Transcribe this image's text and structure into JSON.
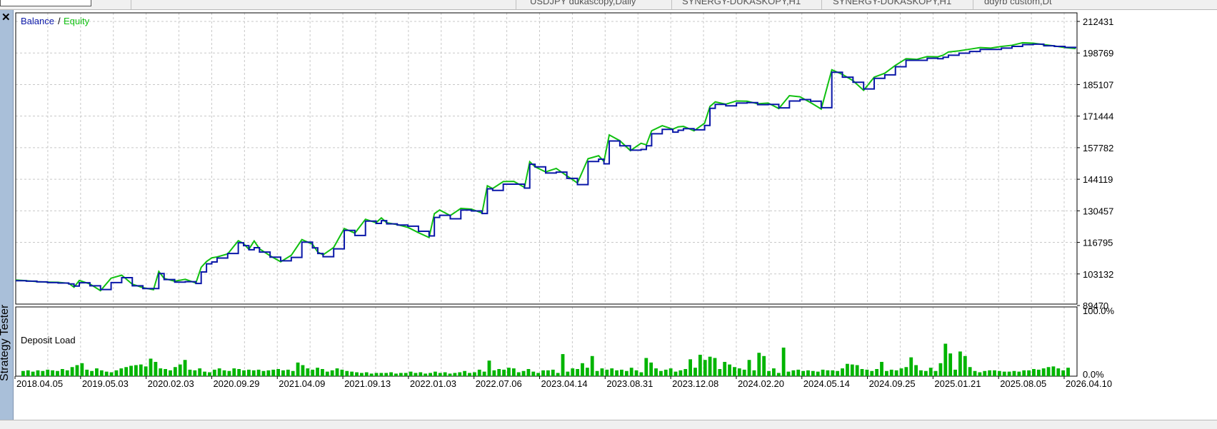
{
  "tabs": {
    "items": [
      "USDJPY dukascopy,Daily",
      "SYNERGY-DUKASKOPY,H1",
      "SYNERGY-DUKASKOPY,H1",
      "ddyrb custom,Dt"
    ]
  },
  "side_panel": {
    "title": "Strategy Tester",
    "close_icon": "close-icon"
  },
  "colors": {
    "balance": "#0a17a8",
    "equity": "#10c010",
    "deposit_bars": "#00b400",
    "grid": "#c8c8c8"
  },
  "chart_data": [
    {
      "type": "line",
      "legend": {
        "balance_label": "Balance",
        "separator": "/",
        "equity_label": "Equity",
        "placement": "top-left"
      },
      "y_ticks": [
        "212431",
        "198769",
        "185107",
        "171444",
        "157782",
        "144119",
        "130457",
        "116795",
        "103132",
        "89470"
      ],
      "ylim": [
        89470,
        212431
      ],
      "grid": true,
      "x": [
        0,
        0.01,
        0.02,
        0.03,
        0.04,
        0.05,
        0.055,
        0.06,
        0.07,
        0.08,
        0.09,
        0.1,
        0.11,
        0.12,
        0.13,
        0.135,
        0.14,
        0.15,
        0.16,
        0.17,
        0.175,
        0.18,
        0.185,
        0.19,
        0.2,
        0.21,
        0.215,
        0.22,
        0.225,
        0.23,
        0.24,
        0.25,
        0.26,
        0.27,
        0.28,
        0.285,
        0.29,
        0.3,
        0.31,
        0.32,
        0.33,
        0.34,
        0.345,
        0.35,
        0.36,
        0.37,
        0.38,
        0.39,
        0.395,
        0.4,
        0.41,
        0.42,
        0.43,
        0.44,
        0.445,
        0.45,
        0.46,
        0.47,
        0.48,
        0.485,
        0.49,
        0.5,
        0.51,
        0.52,
        0.53,
        0.54,
        0.55,
        0.555,
        0.56,
        0.57,
        0.58,
        0.59,
        0.595,
        0.6,
        0.61,
        0.62,
        0.625,
        0.63,
        0.64,
        0.65,
        0.655,
        0.66,
        0.67,
        0.68,
        0.69,
        0.7,
        0.71,
        0.72,
        0.73,
        0.74,
        0.75,
        0.76,
        0.77,
        0.78,
        0.79,
        0.8,
        0.81,
        0.82,
        0.83,
        0.84,
        0.85,
        0.86,
        0.87,
        0.875,
        0.88,
        0.89,
        0.9,
        0.91,
        0.92,
        0.93,
        0.94,
        0.95,
        0.96,
        0.97,
        0.98,
        0.99,
        1.0
      ],
      "series": [
        {
          "name": "Balance",
          "values": [
            100200,
            100000,
            99700,
            99400,
            99200,
            98800,
            97900,
            99300,
            98000,
            96400,
            99400,
            101500,
            98000,
            96800,
            96800,
            103300,
            100700,
            99600,
            99800,
            99000,
            104000,
            107500,
            108300,
            110000,
            112000,
            116600,
            115400,
            113600,
            114500,
            112600,
            110400,
            108800,
            110300,
            116900,
            114400,
            112000,
            110600,
            114000,
            122000,
            119800,
            126000,
            125000,
            126200,
            124800,
            124300,
            123800,
            121600,
            119600,
            127600,
            128500,
            127000,
            130800,
            130400,
            129300,
            140000,
            139300,
            142000,
            142000,
            140300,
            150600,
            149500,
            146800,
            147200,
            144500,
            141800,
            151800,
            152800,
            150800,
            160700,
            158600,
            156700,
            157000,
            158600,
            163800,
            165700,
            164500,
            165300,
            166000,
            165500,
            167400,
            174800,
            176500,
            175900,
            177100,
            177300,
            176400,
            176500,
            175000,
            178000,
            178600,
            177900,
            175100,
            190400,
            188300,
            186100,
            183200,
            187800,
            189300,
            192800,
            195600,
            195600,
            196500,
            196300,
            196900,
            197800,
            198700,
            199400,
            200300,
            200300,
            200900,
            201600,
            202400,
            202600,
            201900,
            201600,
            201200,
            200800
          ]
        },
        {
          "name": "Equity",
          "values": [
            100500,
            100200,
            99800,
            99600,
            99500,
            99100,
            97400,
            100300,
            98800,
            95900,
            101300,
            102600,
            98700,
            97200,
            96300,
            104200,
            101200,
            100000,
            100800,
            99200,
            106000,
            108500,
            110100,
            110500,
            111800,
            117500,
            116300,
            113800,
            117400,
            114000,
            111000,
            108400,
            111200,
            118000,
            116000,
            112600,
            111400,
            114600,
            122800,
            120800,
            126800,
            125300,
            127400,
            125300,
            124500,
            123300,
            121000,
            118900,
            129200,
            130800,
            128400,
            131500,
            131200,
            129500,
            141300,
            140100,
            143100,
            143200,
            140600,
            151700,
            149500,
            147300,
            148800,
            145600,
            142500,
            153000,
            154300,
            151800,
            163300,
            160800,
            156500,
            159700,
            159000,
            165100,
            167300,
            165800,
            166800,
            167000,
            165100,
            168400,
            175600,
            177600,
            176600,
            178000,
            177900,
            176800,
            177100,
            174700,
            180300,
            179800,
            177300,
            174500,
            191500,
            189500,
            186800,
            182600,
            188300,
            190000,
            193400,
            196300,
            196000,
            197200,
            197100,
            197800,
            199200,
            199700,
            200400,
            201100,
            200900,
            201600,
            202100,
            203200,
            203000,
            202400,
            201800,
            201100,
            200700
          ]
        }
      ]
    },
    {
      "type": "bar",
      "title": "Deposit Load",
      "y_ticks": [
        "100.0%",
        "0.0%"
      ],
      "ylim": [
        0,
        100
      ],
      "x_ticks": [
        "2018.04.05",
        "2019.05.03",
        "2020.02.03",
        "2020.09.29",
        "2021.04.09",
        "2021.09.13",
        "2022.01.03",
        "2022.07.06",
        "2023.04.14",
        "2023.08.31",
        "2023.12.08",
        "2024.02.20",
        "2024.05.14",
        "2024.09.25",
        "2025.01.21",
        "2025.08.05",
        "2026.04.10"
      ],
      "series": [
        {
          "name": "Deposit Load",
          "values": [
            8,
            9,
            7,
            9,
            8,
            10,
            9,
            8,
            11,
            9,
            14,
            17,
            20,
            10,
            8,
            12,
            9,
            7,
            6,
            9,
            12,
            14,
            16,
            17,
            18,
            15,
            27,
            22,
            12,
            11,
            9,
            14,
            18,
            25,
            10,
            9,
            12,
            7,
            6,
            10,
            12,
            9,
            8,
            12,
            11,
            9,
            10,
            9,
            10,
            8,
            9,
            10,
            11,
            9,
            10,
            8,
            21,
            17,
            12,
            10,
            13,
            11,
            7,
            9,
            12,
            10,
            8,
            7,
            6,
            5,
            6,
            4,
            5,
            5,
            5,
            6,
            4,
            5,
            5,
            7,
            5,
            6,
            4,
            5,
            7,
            5,
            6,
            4,
            5,
            6,
            8,
            5,
            6,
            10,
            7,
            24,
            9,
            11,
            10,
            13,
            12,
            6,
            8,
            11,
            7,
            5,
            9,
            9,
            10,
            5,
            34,
            7,
            12,
            11,
            20,
            13,
            31,
            8,
            12,
            10,
            12,
            9,
            10,
            8,
            13,
            9,
            6,
            28,
            21,
            12,
            8,
            10,
            12,
            7,
            9,
            11,
            26,
            13,
            33,
            25,
            30,
            28,
            11,
            22,
            18,
            14,
            12,
            10,
            25,
            9,
            36,
            31,
            8,
            12,
            5,
            44,
            7,
            9,
            10,
            8,
            9,
            8,
            7,
            10,
            9,
            9,
            8,
            12,
            19,
            18,
            17,
            11,
            10,
            8,
            11,
            22,
            8,
            10,
            9,
            12,
            14,
            29,
            17,
            9,
            8,
            13,
            8,
            20,
            50,
            35,
            10,
            38,
            31,
            14,
            8,
            6,
            8,
            9,
            9,
            8,
            7,
            7,
            8,
            7,
            9,
            9,
            11,
            10,
            12,
            14,
            15,
            12,
            9,
            13
          ]
        }
      ]
    }
  ]
}
